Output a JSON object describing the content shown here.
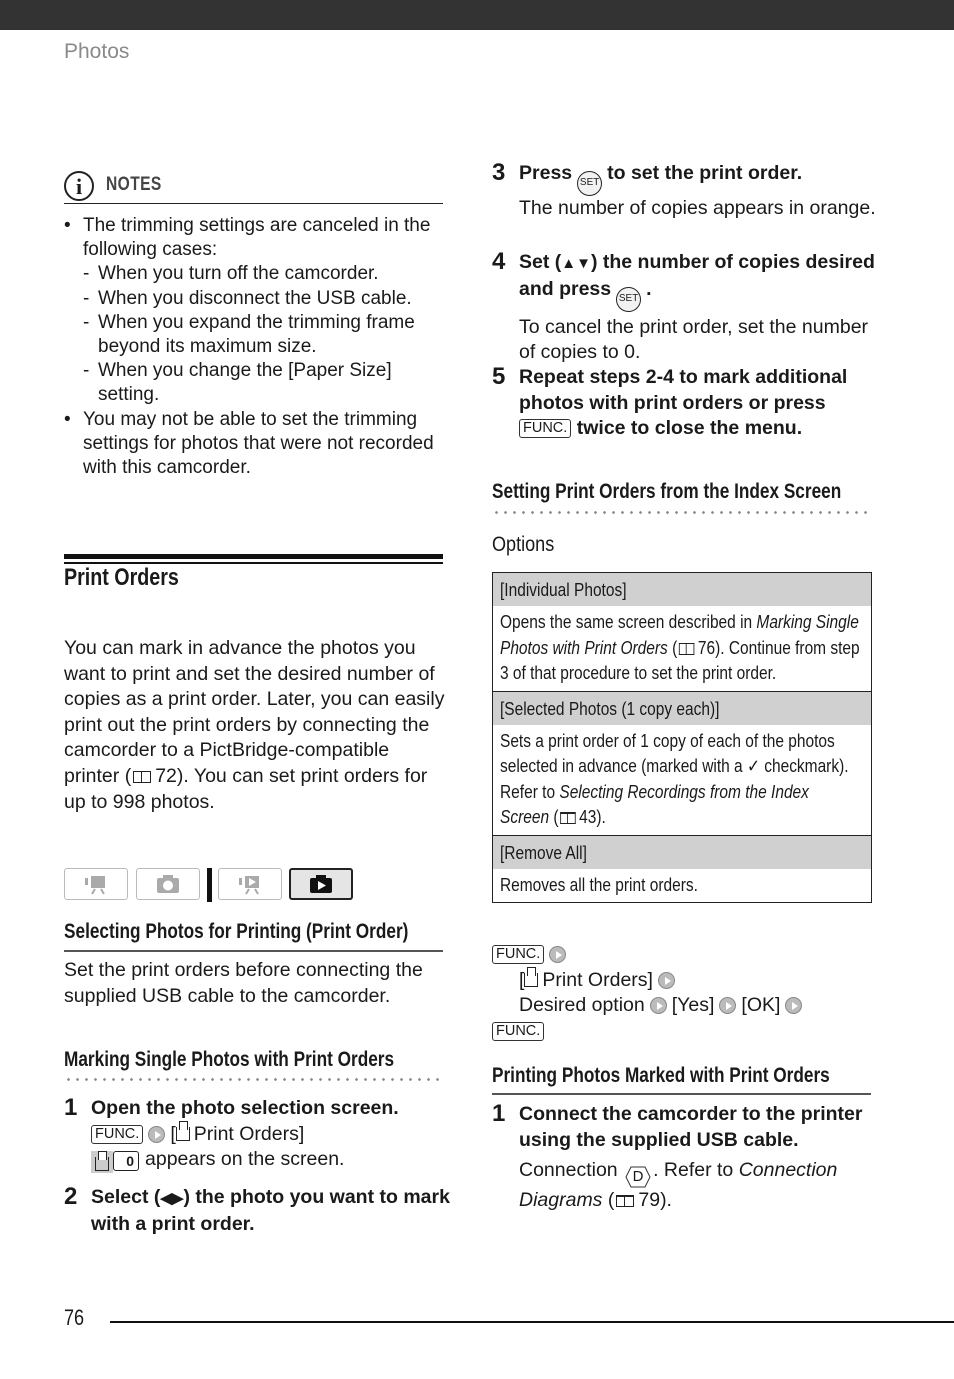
{
  "header": {
    "section_title": "Photos"
  },
  "notes": {
    "label": "NOTES",
    "items": [
      {
        "text": "The trimming settings are canceled in the following cases:",
        "subitems": [
          "When you turn off the camcorder.",
          "When you disconnect the USB cable.",
          "When you expand the trimming frame beyond its maximum size.",
          "When you change the [Paper Size] setting."
        ]
      },
      {
        "text": "You may not be able to set the trimming settings for photos that were not recorded with this camcorder."
      }
    ]
  },
  "print_orders": {
    "title": "Print Orders",
    "intro_a": "You can mark in advance the photos you want to print and set the desired number of copies as a print order. Later, you can easily print out the print orders by connecting the camcorder to a PictBridge-compatible printer (",
    "intro_ref": "72",
    "intro_b": "). You can set print orders for up to 998 photos."
  },
  "mode_icons": [
    {
      "name": "movie-camera-record-mode",
      "active": false
    },
    {
      "name": "photo-camera-record-mode",
      "active": false
    },
    {
      "name": "movie-playback-mode",
      "active": false
    },
    {
      "name": "photo-playback-mode",
      "active": true
    }
  ],
  "selecting": {
    "title": "Selecting Photos for Printing (Print Order)",
    "body": "Set the print orders before connecting the supplied USB cable to the camcorder."
  },
  "marking": {
    "title": "Marking Single Photos with Print Orders",
    "steps": [
      {
        "num": "1",
        "title": "Open the photo selection screen.",
        "func": "FUNC.",
        "menu": "Print Orders",
        "indicator_count": "0",
        "body": "appears on the screen."
      },
      {
        "num": "2",
        "title_a": "Select (",
        "arrows": "◀▶",
        "title_b": ") the photo you want to mark with a print order."
      },
      {
        "num": "3",
        "title_a": "Press",
        "set": "SET",
        "title_b": "to set the print order.",
        "body": "The number of copies appears in orange."
      },
      {
        "num": "4",
        "title_a": "Set (",
        "arrows": "▲▼",
        "title_b": ") the number of copies desired and press",
        "set": "SET",
        "title_c": ".",
        "body": "To cancel the print order, set the number of copies to 0."
      },
      {
        "num": "5",
        "title_a": "Repeat steps 2-4 to mark additional photos with print orders or press",
        "func": "FUNC.",
        "title_b": "twice to close the menu."
      }
    ]
  },
  "index_screen": {
    "title": "Setting Print Orders from the Index Screen",
    "options_label": "Options",
    "options": [
      {
        "header": "[Individual Photos]",
        "desc_a": "Opens the same screen described in ",
        "desc_italic": "Marking Single Photos with Print Orders",
        "desc_ref": "76",
        "desc_b": "). Continue from step 3 of that procedure to set the print order."
      },
      {
        "header": "[Selected Photos (1 copy each)]",
        "desc_a": "Sets a print order of 1 copy of each of the photos selected in advance (marked with a ",
        "check": "✓",
        "desc_b": " checkmark). Refer to ",
        "desc_italic": "Selecting Recordings from the Index Screen",
        "desc_ref": "43",
        "desc_c": ")."
      },
      {
        "header": "[Remove All]",
        "desc_a": "Removes all the print orders."
      }
    ],
    "sequence": {
      "func": "FUNC.",
      "menu": "Print Orders",
      "desired": "Desired option",
      "yes": "[Yes]",
      "ok": "[OK]"
    }
  },
  "printing": {
    "title": "Printing Photos Marked with Print Orders",
    "step": {
      "num": "1",
      "title": "Connect the camcorder to the printer using the supplied USB cable.",
      "body_a": "Connection",
      "conn": "D",
      "body_b": ". Refer to ",
      "body_italic": "Connection Diagrams",
      "body_ref": "79",
      "body_c": ")."
    }
  },
  "footer": {
    "page_number": "76"
  }
}
